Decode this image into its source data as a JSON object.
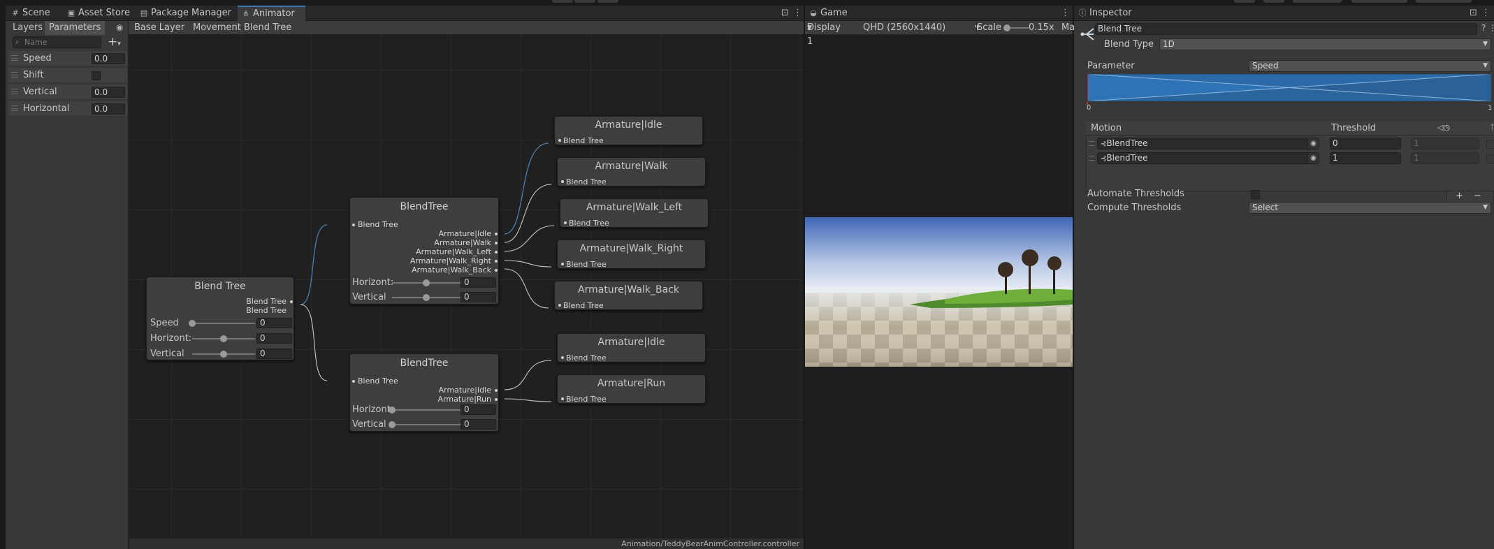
{
  "tabs_left": {
    "scene": "Scene",
    "asset_store": "Asset Store",
    "package_manager": "Package Manager",
    "animator": "Animator"
  },
  "tabs_game": {
    "game": "Game"
  },
  "tabs_inspector": {
    "inspector": "Inspector"
  },
  "animator": {
    "left_tabs": {
      "layers": "Layers",
      "parameters": "Parameters"
    },
    "search_placeholder": "Name",
    "add_button": "+",
    "parameters": [
      {
        "name": "Speed",
        "value": "0.0"
      },
      {
        "name": "Shift",
        "value": ""
      },
      {
        "name": "Vertical",
        "value": "0.0"
      },
      {
        "name": "Horizontal",
        "value": "0.0"
      }
    ],
    "breadcrumb": {
      "base": "Base Layer",
      "current": "Movement Blend Tree"
    },
    "footer_path": "Animation/TeddyBearAnimController.controller",
    "root_node": {
      "title": "Blend Tree",
      "outputs": [
        "Blend Tree",
        "Blend Tree"
      ],
      "params": [
        {
          "name": "Speed",
          "value": "0",
          "level": 0.0
        },
        {
          "name": "Horizont:",
          "value": "0",
          "level": 0.5
        },
        {
          "name": "Vertical",
          "value": "0",
          "level": 0.5
        }
      ]
    },
    "tree_a": {
      "title": "BlendTree",
      "input": "Blend Tree",
      "outputs": [
        "Armature|Idle",
        "Armature|Walk",
        "Armature|Walk_Left",
        "Armature|Walk_Right",
        "Armature|Walk_Back"
      ],
      "params": [
        {
          "name": "Horizont:",
          "value": "0",
          "level": 0.5
        },
        {
          "name": "Vertical",
          "value": "0",
          "level": 0.5
        }
      ]
    },
    "tree_b": {
      "title": "BlendTree",
      "input": "Blend Tree",
      "outputs": [
        "Armature|Idle",
        "Armature|Run"
      ],
      "params": [
        {
          "name": "Horizont:",
          "value": "0",
          "level": 0.0
        },
        {
          "name": "Vertical",
          "value": "0",
          "level": 0.0
        }
      ]
    },
    "motions": [
      {
        "title": "Armature|Idle",
        "label": "Blend Tree"
      },
      {
        "title": "Armature|Walk",
        "label": "Blend Tree"
      },
      {
        "title": "Armature|Walk_Left",
        "label": "Blend Tree"
      },
      {
        "title": "Armature|Walk_Right",
        "label": "Blend Tree"
      },
      {
        "title": "Armature|Walk_Back",
        "label": "Blend Tree"
      },
      {
        "title": "Armature|Idle",
        "label": "Blend Tree"
      },
      {
        "title": "Armature|Run",
        "label": "Blend Tree"
      }
    ]
  },
  "game": {
    "display": "Display 1",
    "resolution": "QHD (2560x1440)",
    "scale_label": "Scale",
    "scale_value": "0.15x",
    "overflow": "Ma"
  },
  "inspector": {
    "name": "Blend Tree",
    "blend_type_label": "Blend Type",
    "blend_type_value": "1D",
    "parameter_label": "Parameter",
    "parameter_value": "Speed",
    "range_min": "0",
    "range_max": "1",
    "motion_header": "Motion",
    "threshold_header": "Threshold",
    "motions": [
      {
        "name": "BlendTree",
        "threshold": "0",
        "speed": "1"
      },
      {
        "name": "BlendTree",
        "threshold": "1",
        "speed": "1"
      }
    ],
    "add": "+",
    "remove": "−",
    "automate_label": "Automate Thresholds",
    "compute_label": "Compute Thresholds",
    "compute_value": "Select"
  },
  "colors": {
    "accent": "#3a79bb",
    "connection_blue": "#4a7fb0",
    "connection_white": "#c8c8c8",
    "panel": "#383838",
    "graph_bg": "#202020"
  }
}
